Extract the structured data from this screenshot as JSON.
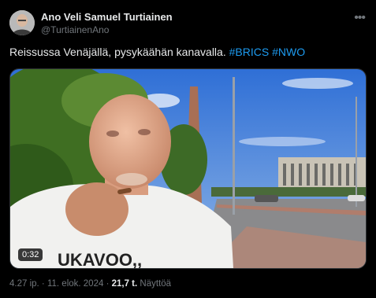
{
  "author": {
    "name": "Ano Veli Samuel Turtiainen",
    "handle": "@TurtiainenAno"
  },
  "post": {
    "text": "Reissussa Venäjällä, pysykäähän kanavalla. ",
    "hashtags": [
      "#BRICS",
      "#NWO"
    ],
    "shirt_text": "UKAVOO,,"
  },
  "video": {
    "duration": "0:32"
  },
  "meta": {
    "time": "4.27 ip.",
    "separator": " · ",
    "date": "11. elok. 2024",
    "views_count": "21,7 t.",
    "views_label": "Näyttöä"
  },
  "colors": {
    "background": "#000000",
    "link": "#1d9bf0",
    "muted": "#71767b",
    "text": "#e7e9ea"
  },
  "icons": [
    "more-options-icon"
  ]
}
